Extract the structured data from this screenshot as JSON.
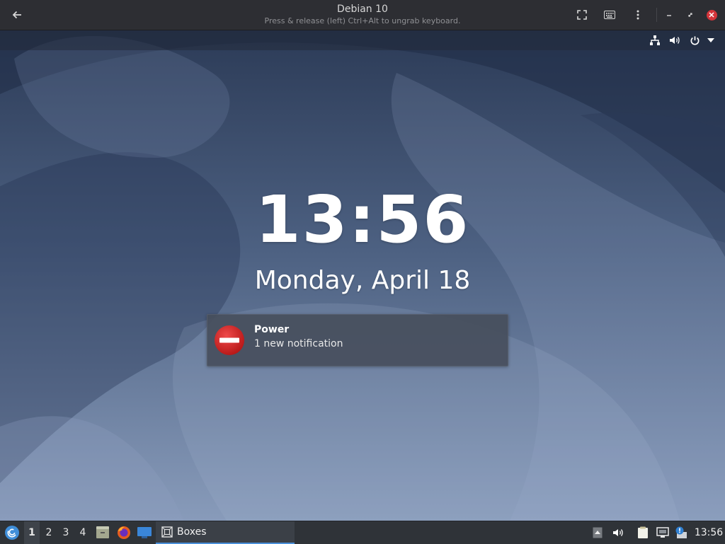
{
  "window": {
    "title": "Debian 10",
    "subtitle": "Press & release (left) Ctrl+Alt to ungrab keyboard."
  },
  "lockscreen": {
    "time": "13:56",
    "date": "Monday, April 18"
  },
  "notification": {
    "title": "Power",
    "body": "1 new notification"
  },
  "taskbar": {
    "workspaces": [
      "1",
      "2",
      "3",
      "4"
    ],
    "active_workspace": "1",
    "task_label": "Boxes",
    "clock": "13:56"
  },
  "colors": {
    "accent": "#4a90d9",
    "close": "#d4353b",
    "notification_icon": "#cc1f1f"
  }
}
